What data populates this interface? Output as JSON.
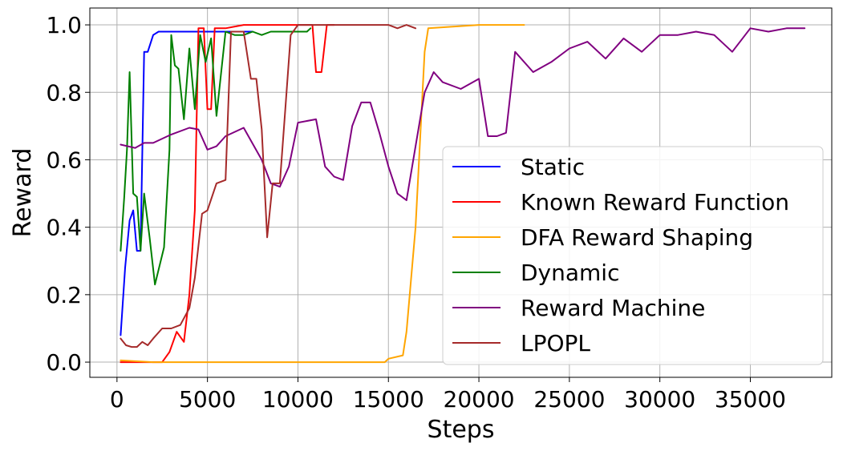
{
  "chart_data": {
    "type": "line",
    "title": "",
    "xlabel": "Steps",
    "ylabel": "Reward",
    "xlim": [
      -1500,
      39500
    ],
    "ylim": [
      -0.045,
      1.05
    ],
    "xticks": [
      0,
      5000,
      10000,
      15000,
      20000,
      25000,
      30000,
      35000
    ],
    "xtick_labels": [
      "0",
      "5000",
      "10000",
      "15000",
      "20000",
      "25000",
      "30000",
      "35000"
    ],
    "yticks": [
      0.0,
      0.2,
      0.4,
      0.6,
      0.8,
      1.0
    ],
    "ytick_labels": [
      "0.0",
      "0.2",
      "0.4",
      "0.6",
      "0.8",
      "1.0"
    ],
    "grid": true,
    "legend_position": "lower-right",
    "series": [
      {
        "name": "Static",
        "color": "#0000ff",
        "x": [
          200,
          450,
          700,
          900,
          1100,
          1300,
          1500,
          1700,
          2000,
          2300,
          2600,
          3000,
          3500,
          4000,
          4500,
          5000,
          5500,
          6000,
          6500,
          7000,
          7500
        ],
        "y": [
          0.08,
          0.28,
          0.42,
          0.45,
          0.33,
          0.33,
          0.92,
          0.92,
          0.97,
          0.98,
          0.98,
          0.98,
          0.98,
          0.98,
          0.98,
          0.98,
          0.98,
          0.98,
          0.98,
          0.98,
          0.98
        ]
      },
      {
        "name": "Known Reward Function",
        "color": "#ff0000",
        "x": [
          200,
          1000,
          1800,
          2500,
          2900,
          3300,
          3700,
          4000,
          4300,
          4500,
          4800,
          5000,
          5200,
          5400,
          6000,
          7000,
          8000,
          9000,
          10000,
          10800,
          11000,
          11300,
          11600,
          12000
        ],
        "y": [
          0.0,
          0.0,
          0.0,
          0.0,
          0.03,
          0.09,
          0.06,
          0.2,
          0.45,
          0.99,
          0.99,
          0.75,
          0.75,
          0.99,
          0.99,
          1.0,
          1.0,
          1.0,
          1.0,
          1.0,
          0.86,
          0.86,
          1.0,
          1.0
        ]
      },
      {
        "name": "DFA Reward Shaping",
        "color": "#ffa500",
        "x": [
          200,
          2000,
          5000,
          10000,
          14800,
          15000,
          15800,
          16000,
          16500,
          17000,
          17200,
          20000,
          22500
        ],
        "y": [
          0.005,
          0.0,
          0.0,
          0.0,
          0.0,
          0.01,
          0.02,
          0.09,
          0.4,
          0.92,
          0.99,
          1.0,
          1.0
        ]
      },
      {
        "name": "Dynamic",
        "color": "#008000",
        "x": [
          200,
          400,
          550,
          700,
          900,
          1100,
          1300,
          1500,
          1800,
          2100,
          2600,
          2900,
          3000,
          3200,
          3400,
          3700,
          4000,
          4300,
          4600,
          4900,
          5200,
          5500,
          6000,
          6500,
          7000,
          7500,
          8000,
          8500,
          9000,
          9500,
          10000,
          10500,
          10700
        ],
        "y": [
          0.33,
          0.49,
          0.63,
          0.86,
          0.5,
          0.49,
          0.33,
          0.5,
          0.37,
          0.23,
          0.34,
          0.63,
          0.97,
          0.88,
          0.87,
          0.72,
          0.93,
          0.75,
          0.97,
          0.89,
          0.96,
          0.73,
          0.98,
          0.97,
          0.97,
          0.98,
          0.97,
          0.98,
          0.98,
          0.98,
          0.98,
          0.98,
          0.99
        ]
      },
      {
        "name": "Reward Machine",
        "color": "#800080",
        "x": [
          200,
          1000,
          1500,
          2000,
          3000,
          4000,
          4500,
          5000,
          5500,
          6000,
          7000,
          8000,
          8500,
          9000,
          9500,
          10000,
          11000,
          11500,
          12000,
          12500,
          13000,
          13500,
          14000,
          14500,
          15000,
          15500,
          16000,
          16500,
          17000,
          17500,
          18000,
          19000,
          20000,
          20500,
          21000,
          21500,
          22000,
          23000,
          24000,
          25000,
          26000,
          27000,
          28000,
          29000,
          30000,
          31000,
          32000,
          33000,
          34000,
          35000,
          36000,
          37000,
          38000
        ],
        "y": [
          0.645,
          0.635,
          0.65,
          0.65,
          0.675,
          0.695,
          0.69,
          0.63,
          0.64,
          0.67,
          0.695,
          0.6,
          0.53,
          0.52,
          0.58,
          0.71,
          0.72,
          0.58,
          0.55,
          0.54,
          0.7,
          0.77,
          0.77,
          0.68,
          0.58,
          0.5,
          0.48,
          0.64,
          0.8,
          0.86,
          0.83,
          0.81,
          0.84,
          0.67,
          0.67,
          0.68,
          0.92,
          0.86,
          0.89,
          0.93,
          0.95,
          0.9,
          0.96,
          0.92,
          0.97,
          0.97,
          0.98,
          0.97,
          0.92,
          0.99,
          0.98,
          0.99,
          0.99
        ]
      },
      {
        "name": "LPOPL",
        "color": "#a52a2a",
        "x": [
          200,
          500,
          800,
          1100,
          1400,
          1700,
          2000,
          2500,
          3000,
          3500,
          4000,
          4300,
          4700,
          5000,
          5500,
          6000,
          6300,
          6700,
          7000,
          7400,
          7700,
          8000,
          8300,
          8600,
          9000,
          9300,
          9600,
          10000,
          11000,
          12000,
          13000,
          14000,
          15000,
          15500,
          16000,
          16500
        ],
        "y": [
          0.07,
          0.05,
          0.045,
          0.045,
          0.06,
          0.05,
          0.07,
          0.1,
          0.1,
          0.11,
          0.16,
          0.25,
          0.44,
          0.45,
          0.53,
          0.54,
          0.98,
          0.98,
          0.98,
          0.84,
          0.84,
          0.69,
          0.37,
          0.53,
          0.53,
          0.75,
          0.97,
          1.0,
          1.0,
          1.0,
          1.0,
          1.0,
          1.0,
          0.99,
          1.0,
          0.99
        ]
      }
    ]
  }
}
